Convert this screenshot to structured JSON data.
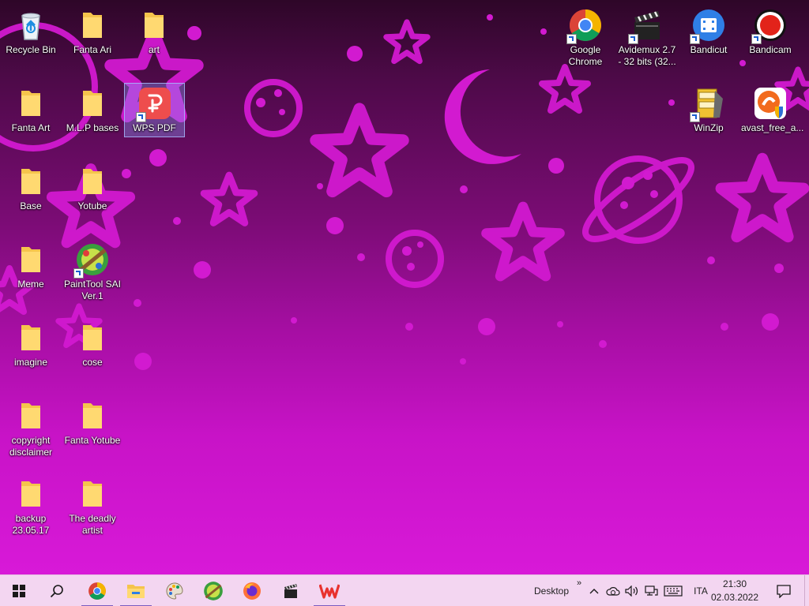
{
  "desktop_icons_left": [
    {
      "label": "Recycle Bin",
      "icon": "recycle-bin-icon"
    },
    {
      "label": "Fanta Ari",
      "icon": "folder-icon"
    },
    {
      "label": "art",
      "icon": "folder-icon"
    },
    {
      "label": "Fanta Art",
      "icon": "folder-icon"
    },
    {
      "label": "M.L.P bases",
      "icon": "folder-icon"
    },
    {
      "label": "WPS PDF",
      "icon": "wps-pdf-icon"
    },
    {
      "label": "Base",
      "icon": "folder-icon"
    },
    {
      "label": "Yotube",
      "icon": "folder-icon"
    },
    {
      "label": "Meme",
      "icon": "folder-icon"
    },
    {
      "label": "PaintTool SAI Ver.1",
      "icon": "painttool-sai-icon"
    },
    {
      "label": "imagine",
      "icon": "folder-icon"
    },
    {
      "label": "cose",
      "icon": "folder-icon"
    },
    {
      "label": "copyright disclaimer",
      "icon": "folder-icon"
    },
    {
      "label": "Fanta Yotube",
      "icon": "folder-icon"
    },
    {
      "label": "backup 23.05.17",
      "icon": "folder-icon"
    },
    {
      "label": "The deadly artist",
      "icon": "folder-icon"
    }
  ],
  "desktop_icons_right": [
    {
      "label": "Google Chrome",
      "icon": "chrome-icon"
    },
    {
      "label": "Avidemux 2.7 - 32 bits (32...",
      "icon": "avidemux-clapperboard-icon"
    },
    {
      "label": "Bandicut",
      "icon": "bandicut-icon"
    },
    {
      "label": "Bandicam",
      "icon": "bandicam-record-icon"
    },
    {
      "label": "WinZip",
      "icon": "winzip-icon"
    },
    {
      "label": "avast_free_a...",
      "icon": "avast-installer-icon"
    }
  ],
  "taskbar": {
    "pinned": [
      {
        "name": "start",
        "icon": "windows-start-icon"
      },
      {
        "name": "search",
        "icon": "search-icon"
      },
      {
        "name": "chrome",
        "icon": "chrome-icon"
      },
      {
        "name": "file-explorer",
        "icon": "file-explorer-icon"
      },
      {
        "name": "paint-palette",
        "icon": "palette-icon"
      },
      {
        "name": "painttool-sai",
        "icon": "painttool-sai-icon"
      },
      {
        "name": "firefox",
        "icon": "firefox-icon"
      },
      {
        "name": "avidemux",
        "icon": "avidemux-clapperboard-icon"
      },
      {
        "name": "wps-office",
        "icon": "wps-office-icon"
      }
    ],
    "desktop_toolbar_label": "Desktop",
    "toolbar_chevron": "»",
    "language": "ITA",
    "time": "21:30",
    "date": "02.03.2022"
  },
  "colors": {
    "wallpaper_top": "#2e0628",
    "wallpaper_bottom": "#d819d8",
    "wallpaper_shapes": "#d21ad0",
    "taskbar": "#f3d6f1",
    "folder": "#f5c44c"
  }
}
